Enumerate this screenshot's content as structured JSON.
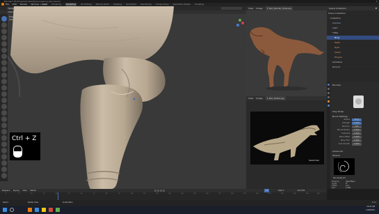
{
  "window": {
    "title": "Blender* [E:\\Projects\\T-Rex\\Tyrannosaurus_Rex.blend]"
  },
  "menu": [
    "File",
    "Edit",
    "Render",
    "Window",
    "Help"
  ],
  "workspaces": [
    "Layout",
    "Modeling",
    "Sculpting",
    "UV Editing",
    "Texture Paint",
    "Shading",
    "Animation",
    "Rendering",
    "Compositing",
    "Geometry Nodes",
    "Scripting"
  ],
  "viewport_header": {
    "mode": "Sculpt Mode",
    "items": [
      "View",
      "Sculpt",
      "Mask",
      "Face Sets"
    ],
    "brush": "Clay Strips"
  },
  "tool_header": {
    "labels": [
      "Radius",
      "Strength",
      "Brush",
      "Texture",
      "Stroke",
      "Falloff",
      "Cursor"
    ]
  },
  "viewport_info": {
    "line1": "User Perspective",
    "line2": "(42) Body"
  },
  "shortcut_overlay": {
    "text": "Ctrl + Z"
  },
  "image_editor_top": {
    "header": "View",
    "items": [
      "View",
      "Image"
    ],
    "image_name": "T_Rex_Render_Side.png"
  },
  "image_editor_bottom": {
    "header": "View",
    "items": [
      "View",
      "Image"
    ],
    "image_name": "T_Rex_Poster.jpg",
    "signature": "Sketchfab"
  },
  "outliner": {
    "header": "Scene Collection",
    "items": [
      "Scene Collection",
      "Collection",
      "Camera",
      "Light",
      "T-Rex",
      "Body",
      "Teeth",
      "Eyes",
      "Claws",
      "Tongue",
      "Armature",
      "Ground"
    ]
  },
  "properties": {
    "brush_name": "Clay Strips",
    "sections": [
      "Brushes",
      "Brush Settings",
      "Advanced",
      "Texture",
      "Stroke",
      "Falloff",
      "Cursor"
    ],
    "fields": [
      {
        "label": "Radius",
        "value": "50 px"
      },
      {
        "label": "Strength",
        "value": "0.500"
      },
      {
        "label": "Direction",
        "value": "Add"
      },
      {
        "label": "Normal Radius",
        "value": "0.500"
      },
      {
        "label": "Hardness",
        "value": "0.000"
      },
      {
        "label": "Plane Offset",
        "value": "0.000"
      },
      {
        "label": "Plane Trim",
        "value": "0.500"
      },
      {
        "label": "Auto-Smooth",
        "value": "0.000"
      }
    ],
    "texture_name": "Tex_Scales_01",
    "texture_fields": [
      {
        "label": "Mapping",
        "value": "View Plane"
      },
      {
        "label": "Angle",
        "value": "0°"
      },
      {
        "label": "Offset",
        "value": "0 m"
      },
      {
        "label": "Size",
        "value": "1.000"
      }
    ]
  },
  "timeline": {
    "items": [
      "Playback",
      "Keying",
      "View",
      "Marker"
    ],
    "ticks": [
      "0",
      "10",
      "20",
      "30",
      "40",
      "50",
      "60",
      "70",
      "80",
      "90",
      "100",
      "110",
      "120",
      "130",
      "140",
      "150",
      "160",
      "170",
      "180",
      "190",
      "200",
      "210",
      "220",
      "230",
      "240",
      "250"
    ],
    "current_frame": "42",
    "start": "Start 1",
    "end": "End 250"
  },
  "statusbar": {
    "left": "Select",
    "middle": "Rotate View",
    "right": "Sculpt Menu",
    "version": "3.4.1"
  },
  "taskbar": {
    "time": "10:42 AM",
    "date": "1/18/2023"
  },
  "colors": {
    "accent": "#4772b3",
    "clay": "#c7b8a3",
    "bg": "#393939"
  }
}
